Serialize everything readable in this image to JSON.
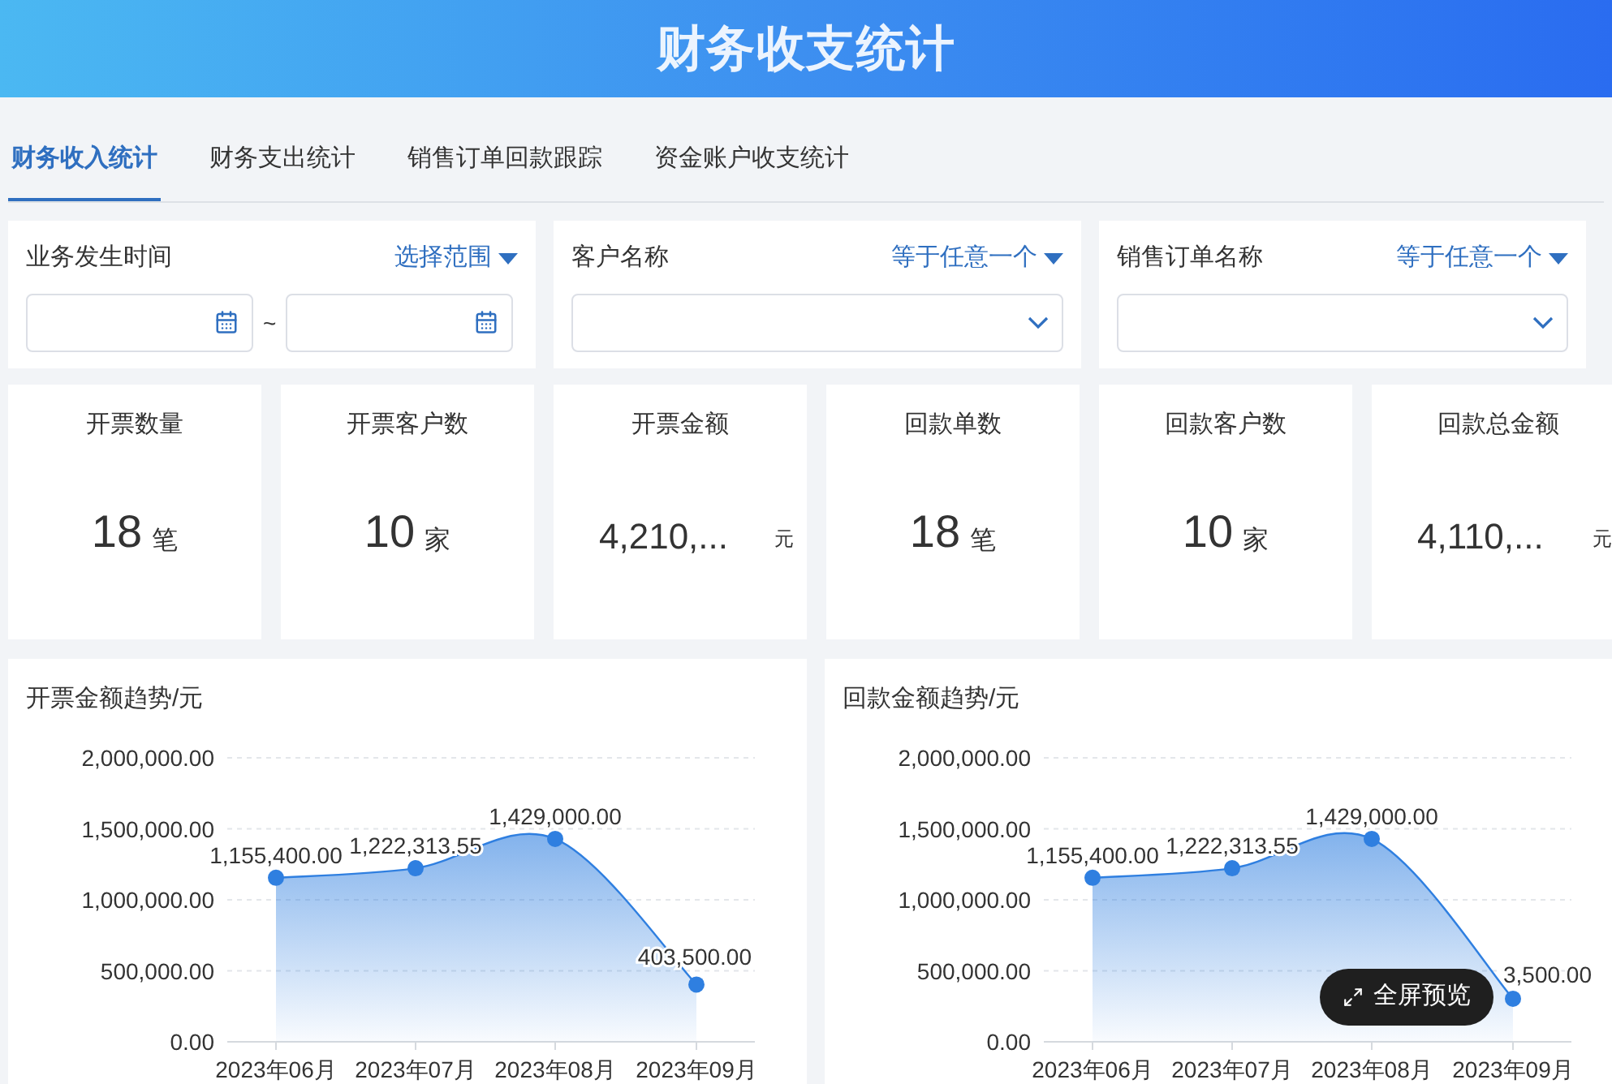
{
  "header": {
    "title": "财务收支统计"
  },
  "tabs": [
    {
      "label": "财务收入统计",
      "selected": true
    },
    {
      "label": "财务支出统计",
      "selected": false
    },
    {
      "label": "销售订单回款跟踪",
      "selected": false
    },
    {
      "label": "资金账户收支统计",
      "selected": false
    }
  ],
  "filters": [
    {
      "kind": "date_range",
      "label": "业务发生时间",
      "operator": "选择范围",
      "separator": "~"
    },
    {
      "kind": "select",
      "label": "客户名称",
      "operator": "等于任意一个"
    },
    {
      "kind": "select",
      "label": "销售订单名称",
      "operator": "等于任意一个"
    }
  ],
  "stats": [
    {
      "label": "开票数量",
      "value": "18",
      "unit": "笔",
      "truncated": false
    },
    {
      "label": "开票客户数",
      "value": "10",
      "unit": "家",
      "truncated": false
    },
    {
      "label": "开票金额",
      "value": "4,210,...",
      "unit": "元",
      "truncated": true
    },
    {
      "label": "回款单数",
      "value": "18",
      "unit": "笔",
      "truncated": false
    },
    {
      "label": "回款客户数",
      "value": "10",
      "unit": "家",
      "truncated": false
    },
    {
      "label": "回款总金额",
      "value": "4,110,...",
      "unit": "元",
      "truncated": true
    }
  ],
  "charts": [
    {
      "title": "开票金额趋势/元",
      "chart_data": {
        "type": "area",
        "categories": [
          "2023年06月",
          "2023年07月",
          "2023年08月",
          "2023年09月"
        ],
        "series": [
          {
            "color": "#2f7fe0",
            "values": [
              1155400,
              1222314,
              1429000,
              403500
            ]
          }
        ],
        "grid": true,
        "ylim": [
          0,
          2000000
        ],
        "yticks": [
          {
            "value": 0,
            "label": "0.00"
          },
          {
            "value": 500000,
            "label": "500,000.00"
          },
          {
            "value": 1000000,
            "label": "1,000,000.00"
          },
          {
            "value": 1500000,
            "label": "1,500,000.00"
          },
          {
            "value": 2000000,
            "label": "2,000,000.00"
          }
        ],
        "value_labels": [
          "1,155,400.00",
          "1,222,313.55",
          "1,429,000.00",
          "403,500.00"
        ]
      }
    },
    {
      "title": "回款金额趋势/元",
      "chart_data": {
        "type": "area",
        "categories": [
          "2023年06月",
          "2023年07月",
          "2023年08月",
          "2023年09月"
        ],
        "series": [
          {
            "color": "#2f7fe0",
            "values": [
              1155400,
              1222314,
              1429000,
              303500
            ]
          }
        ],
        "grid": true,
        "ylim": [
          0,
          2000000
        ],
        "yticks": [
          {
            "value": 0,
            "label": "0.00"
          },
          {
            "value": 500000,
            "label": "500,000.00"
          },
          {
            "value": 1000000,
            "label": "1,000,000.00"
          },
          {
            "value": 1500000,
            "label": "1,500,000.00"
          },
          {
            "value": 2000000,
            "label": "2,000,000.00"
          }
        ],
        "value_labels": [
          "1,155,400.00",
          "1,222,313.55",
          "1,429,000.00",
          "3,500.00"
        ]
      }
    }
  ],
  "fullscreen_button": {
    "label": "全屏预览"
  }
}
